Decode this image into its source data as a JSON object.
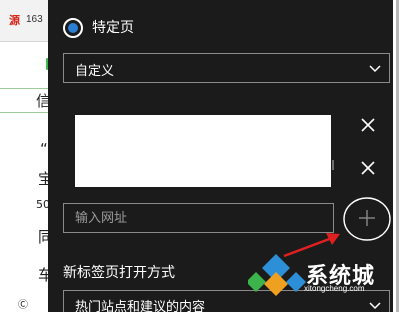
{
  "background_page": {
    "tab_logo": "源",
    "tab_number": "163",
    "glyphs": [
      "信",
      "“",
      "宝",
      "50",
      "同",
      "车",
      "Ⓒ"
    ]
  },
  "settings": {
    "radio_specific_page": "特定页",
    "select_custom": "自定义",
    "url_placeholder": "输入网址",
    "new_tab_label": "新标签页打开方式",
    "new_tab_value": "热门站点和建议的内容"
  },
  "watermark": {
    "brand": "系统城",
    "domain": "xitongcheng.com"
  },
  "colors": {
    "panel_bg": "#1b1b1b",
    "accent_blue": "#2a7fd4",
    "annotation_red": "#e02020",
    "tab_red": "#d9251c"
  },
  "icons": [
    "radio-selected-icon",
    "chevron-down-icon",
    "close-icon",
    "add-icon",
    "annotation-arrow-icon"
  ]
}
